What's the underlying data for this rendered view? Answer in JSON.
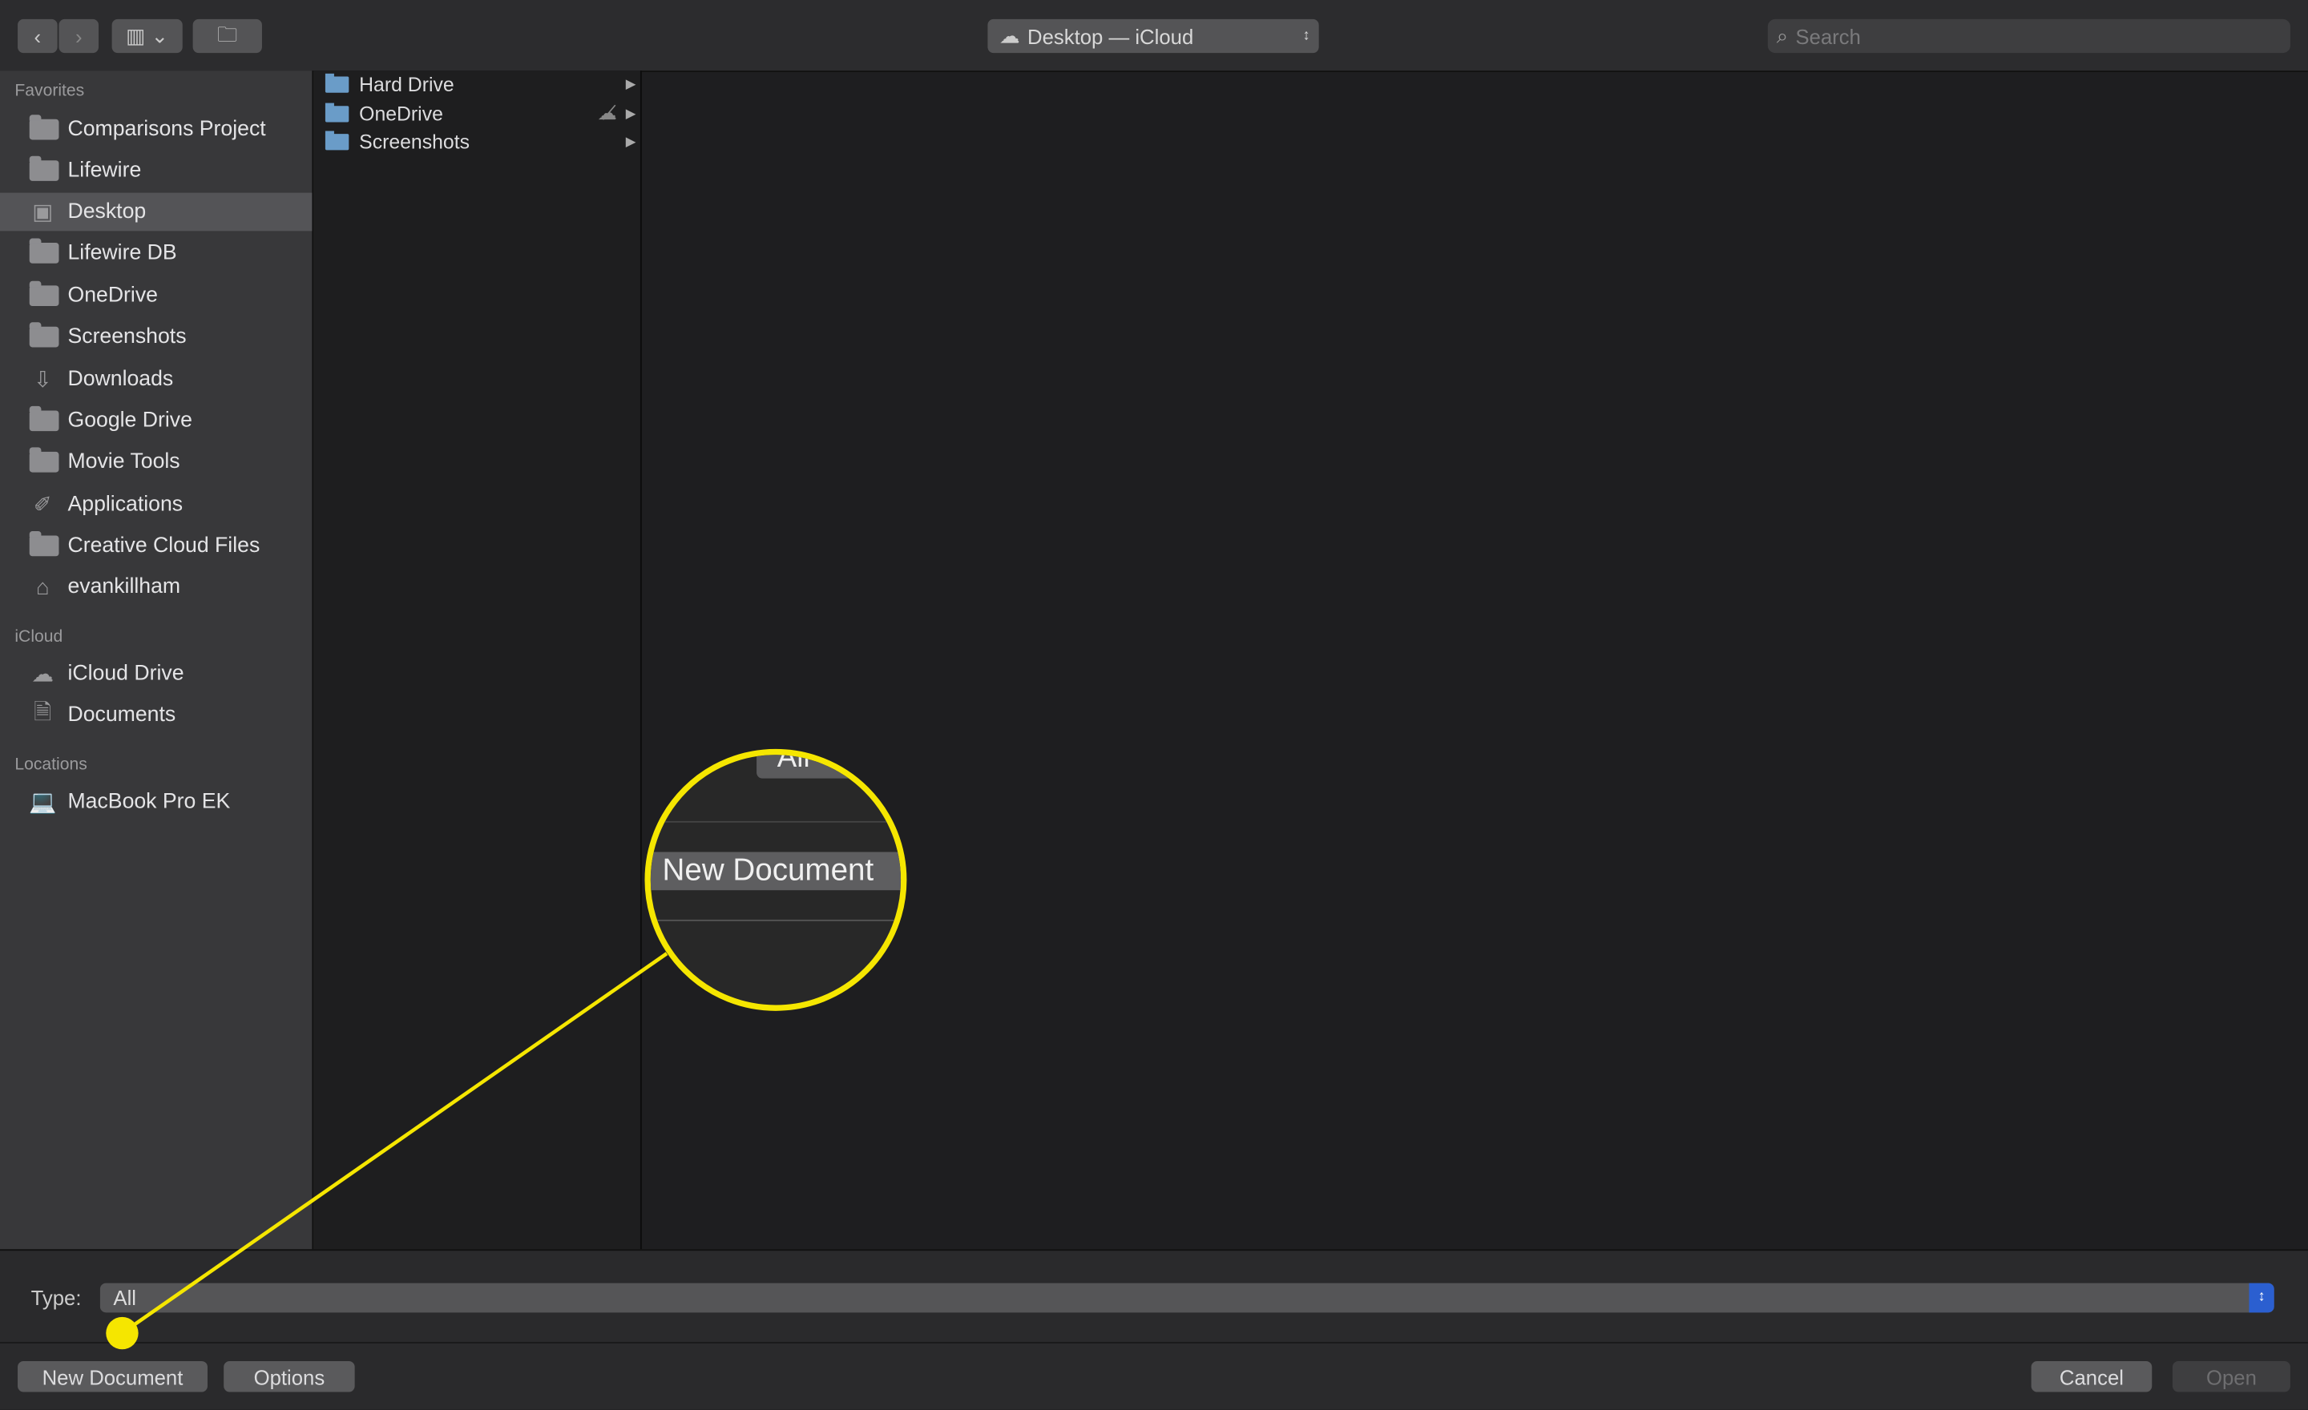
{
  "toolbar": {
    "back_icon": "chevron-left-icon",
    "forward_icon": "chevron-right-icon",
    "view_icon": "columns-view-icon",
    "new_folder_icon": "new-folder-icon",
    "location": "Desktop — iCloud",
    "search_placeholder": "Search"
  },
  "sidebar": {
    "favorites_header": "Favorites",
    "favorites": [
      {
        "label": "Comparisons Project",
        "icon": "folder-icon"
      },
      {
        "label": "Lifewire",
        "icon": "folder-icon"
      },
      {
        "label": "Desktop",
        "icon": "desktop-icon",
        "selected": true
      },
      {
        "label": "Lifewire DB",
        "icon": "folder-icon"
      },
      {
        "label": "OneDrive",
        "icon": "folder-icon"
      },
      {
        "label": "Screenshots",
        "icon": "folder-icon"
      },
      {
        "label": "Downloads",
        "icon": "download-icon"
      },
      {
        "label": "Google Drive",
        "icon": "folder-icon"
      },
      {
        "label": "Movie Tools",
        "icon": "folder-icon"
      },
      {
        "label": "Applications",
        "icon": "applications-icon"
      },
      {
        "label": "Creative Cloud Files",
        "icon": "folder-icon"
      },
      {
        "label": "evankillham",
        "icon": "home-icon"
      }
    ],
    "icloud_header": "iCloud",
    "icloud": [
      {
        "label": "iCloud Drive",
        "icon": "cloud-icon"
      },
      {
        "label": "Documents",
        "icon": "documents-icon"
      }
    ],
    "locations_header": "Locations",
    "locations": [
      {
        "label": "MacBook Pro EK",
        "icon": "laptop-icon"
      }
    ]
  },
  "column": [
    {
      "label": "Hard Drive"
    },
    {
      "label": "OneDrive",
      "badge": "cloud-off-icon"
    },
    {
      "label": "Screenshots"
    }
  ],
  "bottom": {
    "type_label": "Type:",
    "type_value": "All",
    "new_document": "New Document",
    "options": "Options",
    "cancel": "Cancel",
    "open": "Open"
  },
  "callout": {
    "magnified_label": "New Document",
    "magnified_partial": "All",
    "color": "#f5e600"
  }
}
